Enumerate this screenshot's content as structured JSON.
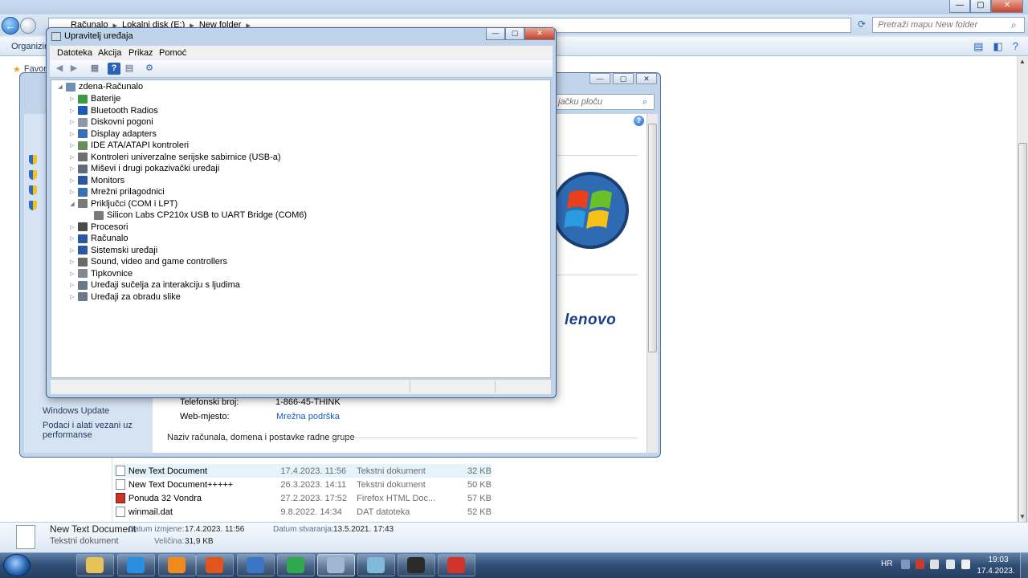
{
  "explorer": {
    "breadcrumb": [
      "Računalo",
      "Lokalni disk (E:)",
      "New folder"
    ],
    "search_placeholder": "Pretraži mapu New folder",
    "organize_label": "Organiziraj",
    "favorites_label": "Favoriti",
    "files": [
      {
        "name": "New Text Document",
        "date": "17.4.2023. 11:56",
        "type": "Tekstni dokument",
        "size": "32 KB",
        "icon": "text-file-icon",
        "selected": true
      },
      {
        "name": "New Text Document+++++",
        "date": "26.3.2023. 14:11",
        "type": "Tekstni dokument",
        "size": "50 KB",
        "icon": "text-file-icon"
      },
      {
        "name": "Ponuda 32 Vondra",
        "date": "27.2.2023. 17:52",
        "type": "Firefox HTML Doc...",
        "size": "57 KB",
        "icon": "html-file-icon"
      },
      {
        "name": "winmail.dat",
        "date": "9.8.2022. 14:34",
        "type": "DAT datoteka",
        "size": "52 KB",
        "icon": "dat-file-icon"
      }
    ],
    "details": {
      "name": "New Text Document",
      "type": "Tekstni dokument",
      "modified_label": "Datum izmjene:",
      "modified_value": "17.4.2023. 11:56",
      "created_label": "Datum stvaranja:",
      "created_value": "13.5.2021. 17:43",
      "size_label": "Veličina:",
      "size_value": "31,9 KB"
    }
  },
  "system_properties": {
    "search_placeholder": "jačku ploču",
    "left_links": [
      "Windows Update",
      "Podaci i alati vezani uz performanse"
    ],
    "phone_label": "Telefonski broj:",
    "phone_value": "1-866-45-THINK",
    "web_label": "Web-mjesto:",
    "web_value": "Mrežna podrška",
    "section_title": "Naziv računala, domena i postavke radne grupe",
    "brand": "lenovo"
  },
  "device_manager": {
    "title": "Upravitelj uređaja",
    "menu": [
      "Datoteka",
      "Akcija",
      "Prikaz",
      "Pomoć"
    ],
    "root": "zdena-Računalo",
    "categories": [
      {
        "label": "Baterije",
        "icon": "battery-icon",
        "color": "#3c9a45"
      },
      {
        "label": "Bluetooth Radios",
        "icon": "bluetooth-icon",
        "color": "#1e5bb7"
      },
      {
        "label": "Diskovni pogoni",
        "icon": "disk-drive-icon",
        "color": "#8c98a6"
      },
      {
        "label": "Display adapters",
        "icon": "display-adapter-icon",
        "color": "#3a6fb5"
      },
      {
        "label": "IDE ATA/ATAPI kontroleri",
        "icon": "ide-controller-icon",
        "color": "#6b8d5a"
      },
      {
        "label": "Kontroleri univerzalne serijske sabirnice (USB-a)",
        "icon": "usb-icon",
        "color": "#707070"
      },
      {
        "label": "Miševi i drugi pokazivački uređaji",
        "icon": "mouse-icon",
        "color": "#606a78"
      },
      {
        "label": "Monitors",
        "icon": "monitor-icon",
        "color": "#2a57a4"
      },
      {
        "label": "Mrežni prilagodnici",
        "icon": "network-adapter-icon",
        "color": "#3a6fb5"
      },
      {
        "label": "Priključci (COM i LPT)",
        "icon": "port-icon",
        "color": "#7a7a7a",
        "expanded": true
      },
      {
        "label": "Silicon Labs CP210x USB to UART Bridge (COM6)",
        "icon": "port-icon",
        "color": "#7a7a7a",
        "child": true
      },
      {
        "label": "Procesori",
        "icon": "processor-icon",
        "color": "#4a4a4a"
      },
      {
        "label": "Računalo",
        "icon": "computer-icon",
        "color": "#2a57a4"
      },
      {
        "label": "Sistemski uređaji",
        "icon": "system-device-icon",
        "color": "#2a57a4"
      },
      {
        "label": "Sound, video and game controllers",
        "icon": "sound-icon",
        "color": "#6a6a6a"
      },
      {
        "label": "Tipkovnice",
        "icon": "keyboard-icon",
        "color": "#808890"
      },
      {
        "label": "Uređaji sučelja za interakciju s ljudima",
        "icon": "hid-icon",
        "color": "#6a7a8a"
      },
      {
        "label": "Uređaji za obradu slike",
        "icon": "imaging-icon",
        "color": "#6a7a8a"
      }
    ]
  },
  "taskbar": {
    "language": "HR",
    "time": "19:03",
    "date": "17.4.2023.",
    "apps": [
      {
        "name": "explorer",
        "color": "#e6c25a"
      },
      {
        "name": "internet-explorer",
        "color": "#2a8fe0"
      },
      {
        "name": "media-player",
        "color": "#f08a1e"
      },
      {
        "name": "firefox",
        "color": "#e0541e"
      },
      {
        "name": "thunderbird",
        "color": "#3a76c4"
      },
      {
        "name": "chrome",
        "color": "#2fa84f"
      },
      {
        "name": "device-manager",
        "color": "#9fb6d4"
      },
      {
        "name": "notepad",
        "color": "#7fb8d8"
      },
      {
        "name": "terminal",
        "color": "#2b2b2b"
      },
      {
        "name": "toolbox",
        "color": "#d0342c"
      }
    ]
  }
}
